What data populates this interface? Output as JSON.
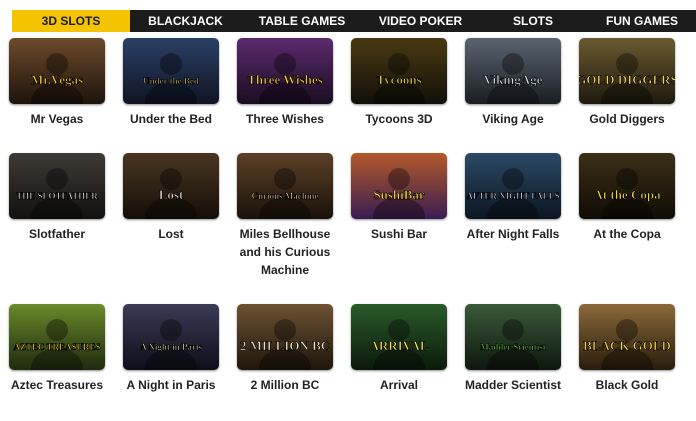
{
  "tabs": [
    {
      "label": "3D SLOTS",
      "active": true
    },
    {
      "label": "BLACKJACK",
      "active": false
    },
    {
      "label": "TABLE GAMES",
      "active": false
    },
    {
      "label": "VIDEO POKER",
      "active": false
    },
    {
      "label": "SLOTS",
      "active": false
    },
    {
      "label": "FUN GAMES",
      "active": false
    }
  ],
  "colors": {
    "accent": "#f5c400",
    "tab_bar": "#1c1c1c",
    "text": "#222222"
  },
  "games": [
    {
      "name": "Mr Vegas",
      "logo": "Mr.Vegas",
      "c1": "#6d4a2c",
      "c2": "#1e140c",
      "logo_color": "#f0c93a",
      "icon": "game-thumbnail"
    },
    {
      "name": "Under the Bed",
      "logo": "Under the Bed",
      "c1": "#2a4066",
      "c2": "#101424",
      "logo_color": "#d8b86a",
      "icon": "game-thumbnail"
    },
    {
      "name": "Three Wishes",
      "logo": "Three Wishes",
      "c1": "#5b2a6e",
      "c2": "#1a0d22",
      "logo_color": "#ffcf33",
      "icon": "game-thumbnail"
    },
    {
      "name": "Tycoons 3D",
      "logo": "Tycoons",
      "c1": "#4a3a12",
      "c2": "#12100a",
      "logo_color": "#e6c84a",
      "icon": "game-thumbnail"
    },
    {
      "name": "Viking Age",
      "logo": "VikingAge",
      "c1": "#5a6470",
      "c2": "#1a1e24",
      "logo_color": "#d9dde2",
      "icon": "game-thumbnail"
    },
    {
      "name": "Gold Diggers",
      "logo": "GOLD DIGGERS",
      "c1": "#6a5a30",
      "c2": "#1e1a0e",
      "logo_color": "#f3d46a",
      "icon": "game-thumbnail"
    },
    {
      "name": "Slotfather",
      "logo": "THE SLOTFATHER",
      "c1": "#3e3a36",
      "c2": "#121110",
      "logo_color": "#f2f2f2",
      "icon": "game-thumbnail"
    },
    {
      "name": "Lost",
      "logo": "Lost",
      "c1": "#4a3620",
      "c2": "#140e08",
      "logo_color": "#efe6d0",
      "icon": "game-thumbnail"
    },
    {
      "name": "Miles Bellhouse and his Curious Machine",
      "logo": "Curious Machine",
      "c1": "#5c4026",
      "c2": "#1a120a",
      "logo_color": "#e8d7a8",
      "icon": "game-thumbnail"
    },
    {
      "name": "Sushi Bar",
      "logo": "SushiBar",
      "c1": "#b35a2a",
      "c2": "#3a1c52",
      "logo_color": "#ffe04a",
      "icon": "game-thumbnail"
    },
    {
      "name": "After Night Falls",
      "logo": "AFTER NIGHT FALLS",
      "c1": "#2c4a66",
      "c2": "#0c1622",
      "logo_color": "#d8e6f2",
      "icon": "game-thumbnail"
    },
    {
      "name": "At the Copa",
      "logo": "At the Copa",
      "c1": "#3a3016",
      "c2": "#100c06",
      "logo_color": "#f2cf4a",
      "icon": "game-thumbnail"
    },
    {
      "name": "Aztec Treasures",
      "logo": "AZTEC TREASURES",
      "c1": "#6a8a2a",
      "c2": "#1e2a0e",
      "logo_color": "#ffcf2a",
      "icon": "game-thumbnail"
    },
    {
      "name": "A Night in Paris",
      "logo": "A Night in Paris",
      "c1": "#3c3a56",
      "c2": "#0e0e1a",
      "logo_color": "#e6d6a8",
      "icon": "game-thumbnail"
    },
    {
      "name": "2 Million BC",
      "logo": "2 MILLION BC",
      "c1": "#6e5232",
      "c2": "#1e160c",
      "logo_color": "#f0e6c8",
      "icon": "game-thumbnail"
    },
    {
      "name": "Arrival",
      "logo": "ARRIVAL",
      "c1": "#2a5a2a",
      "c2": "#0c1a0c",
      "logo_color": "#f6e24a",
      "icon": "game-thumbnail"
    },
    {
      "name": "Madder Scientist",
      "logo": "Madder Scientist",
      "c1": "#3a5a3a",
      "c2": "#0e180e",
      "logo_color": "#7bd84a",
      "icon": "game-thumbnail"
    },
    {
      "name": "Black Gold",
      "logo": "BLACK GOLD",
      "c1": "#8a6a3a",
      "c2": "#2a1c0c",
      "logo_color": "#f4d04a",
      "icon": "game-thumbnail"
    }
  ]
}
